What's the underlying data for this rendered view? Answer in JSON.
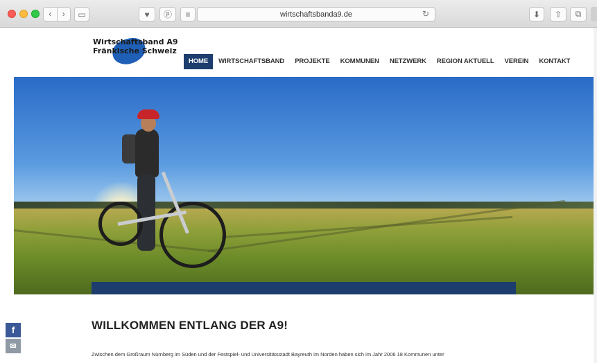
{
  "browser": {
    "url": "wirtschaftsbanda9.de",
    "icons": [
      "back-icon",
      "forward-icon",
      "sidebar-icon",
      "pocket-icon",
      "pinterest-icon",
      "reader-icon",
      "reload-icon",
      "download-icon",
      "share-icon",
      "tabs-icon"
    ]
  },
  "logo": {
    "line1": "Wirtschaftsband A9",
    "line2": "Fränkische Schweiz"
  },
  "nav": {
    "items": [
      "HOME",
      "WIRTSCHAFTSBAND",
      "PROJEKTE",
      "KOMMUNEN",
      "NETZWERK",
      "REGION AKTUELL",
      "VEREIN",
      "KONTAKT"
    ],
    "active": "HOME"
  },
  "social": {
    "facebook": "f",
    "mail": "✉"
  },
  "content": {
    "heading": "WILLKOMMEN ENTLANG DER A9!",
    "paragraph_line1": "Zwischen dem Großraum Nürnberg im Süden und der Festspiel- und Universitätsstadt Bayreuth im Norden haben sich im Jahr 2006 18 Kommunen unter"
  },
  "colors": {
    "nav_active": "#1c3d6e",
    "accent_band": "#1c3d6e",
    "facebook": "#3b5998"
  }
}
